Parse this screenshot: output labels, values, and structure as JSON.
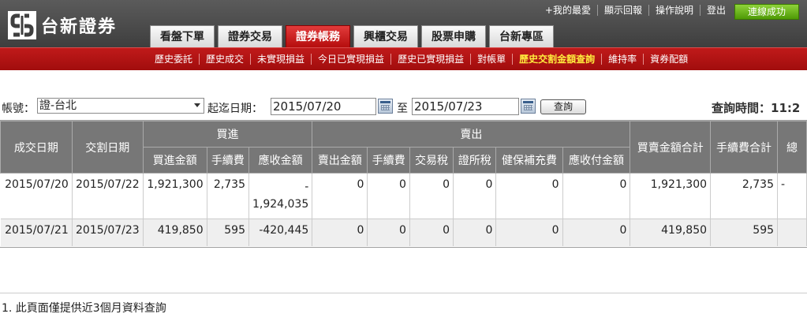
{
  "brand": {
    "name": "台新證券"
  },
  "top_links": [
    "+我的最愛",
    "顯示回報",
    "操作說明",
    "登出"
  ],
  "connection_status": "連線成功",
  "main_tabs": [
    {
      "label": "看盤下單",
      "active": false
    },
    {
      "label": "證券交易",
      "active": false
    },
    {
      "label": "證券帳務",
      "active": true
    },
    {
      "label": "興櫃交易",
      "active": false
    },
    {
      "label": "股票申購",
      "active": false
    },
    {
      "label": "台新專區",
      "active": false
    }
  ],
  "sub_nav": [
    {
      "label": "歷史委託",
      "active": false
    },
    {
      "label": "歷史成交",
      "active": false
    },
    {
      "label": "未實現損益",
      "active": false
    },
    {
      "label": "今日已實現損益",
      "active": false
    },
    {
      "label": "歷史已實現損益",
      "active": false
    },
    {
      "label": "對帳單",
      "active": false
    },
    {
      "label": "歷史交割金額查詢",
      "active": true
    },
    {
      "label": "維持率",
      "active": false
    },
    {
      "label": "資券配額",
      "active": false
    }
  ],
  "query": {
    "account_label": "帳號：",
    "account_value": "證-台北",
    "date_label": "起迄日期：",
    "start_date": "2015/07/20",
    "to_label": "至",
    "end_date": "2015/07/23",
    "query_button": "查詢",
    "query_time_label": "查詢時間：11:2"
  },
  "table": {
    "headers": {
      "trade_date": "成交日期",
      "settle_date": "交割日期",
      "buy_group": "買進",
      "sell_group": "賣出",
      "buy_cols": [
        "買進金額",
        "手續費",
        "應收金額"
      ],
      "sell_cols": [
        "賣出金額",
        "手續費",
        "交易稅",
        "證所稅",
        "健保補充費",
        "應收付金額"
      ],
      "total_amount": "買賣金額合計",
      "total_fee": "手續費合計",
      "extra": "總"
    },
    "rows": [
      {
        "trade_date": "2015/07/20",
        "settle_date": "2015/07/22",
        "buy_amount": "1,921,300",
        "buy_fee": "2,735",
        "receivable_dash": "-",
        "receivable": "1,924,035",
        "sell_amount": "0",
        "sell_fee": "0",
        "tx_tax": "0",
        "cap_tax": "0",
        "nhi": "0",
        "payable": "0",
        "total_amount": "1,921,300",
        "total_fee": "2,735",
        "extra": "-"
      },
      {
        "trade_date": "2015/07/21",
        "settle_date": "2015/07/23",
        "buy_amount": "419,850",
        "buy_fee": "595",
        "receivable_dash": "",
        "receivable": "-420,445",
        "sell_amount": "0",
        "sell_fee": "0",
        "tx_tax": "0",
        "cap_tax": "0",
        "nhi": "0",
        "payable": "0",
        "total_amount": "419,850",
        "total_fee": "595",
        "extra": ""
      }
    ]
  },
  "footnote": "1. 此頁面僅提供近3個月資料查詢",
  "colors": {
    "header_bg": "#4a4a4a",
    "active_tab": "#c41e1e",
    "subnav_bg": "#b01414",
    "table_header": "#777777",
    "connected": "#5aa81a"
  }
}
